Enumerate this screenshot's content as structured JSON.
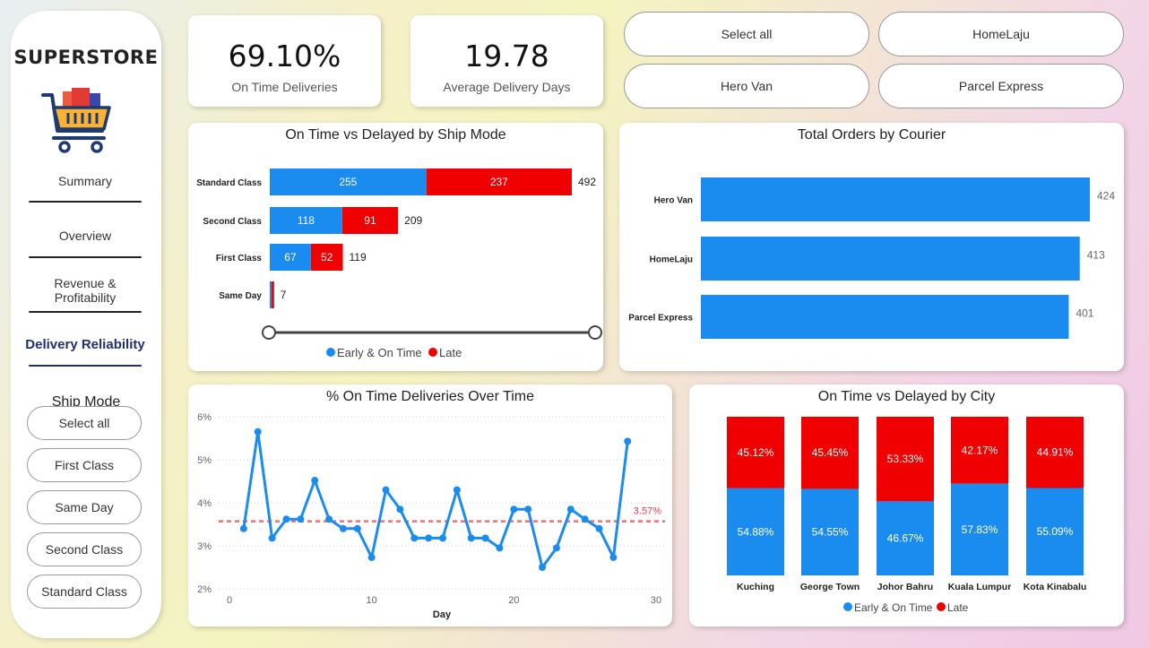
{
  "brand": "SUPERSTORE",
  "nav": [
    {
      "label": "Summary"
    },
    {
      "label": "Overview"
    },
    {
      "label": "Revenue & Profitability"
    },
    {
      "label": "Delivery Reliability"
    }
  ],
  "ship_mode_title": "Ship Mode",
  "ship_mode_buttons": [
    "Select all",
    "First Class",
    "Same Day",
    "Second Class",
    "Standard Class"
  ],
  "courier_buttons": [
    "Select all",
    "HomeLaju",
    "Hero Van",
    "Parcel Express"
  ],
  "kpis": [
    {
      "value": "69.10%",
      "label": "On Time Deliveries"
    },
    {
      "value": "19.78",
      "label": "Average Delivery Days"
    }
  ],
  "colors": {
    "on_time": "#1a8cf0",
    "late": "#f00000",
    "avg_line": "#f07070"
  },
  "chart_data": [
    {
      "type": "bar",
      "title": "On Time vs Delayed by Ship Mode",
      "categories": [
        "Standard Class",
        "Second Class",
        "First Class",
        "Same Day"
      ],
      "series": [
        {
          "name": "Early & On Time",
          "values": [
            255,
            118,
            67,
            3
          ]
        },
        {
          "name": "Late",
          "values": [
            237,
            91,
            52,
            4
          ]
        }
      ],
      "totals": [
        "492",
        "209",
        "119",
        "7"
      ],
      "segment_labels": [
        [
          "255",
          "237"
        ],
        [
          "118",
          "91"
        ],
        [
          "67",
          "52"
        ],
        [
          "",
          ""
        ]
      ],
      "legend": [
        "Early & On Time",
        "Late"
      ],
      "orientation": "horizontal-stacked"
    },
    {
      "type": "bar",
      "title": "Total Orders by Courier",
      "categories": [
        "Hero Van",
        "HomeLaju",
        "Parcel Express"
      ],
      "values": [
        424,
        413,
        401
      ],
      "value_labels": [
        "424",
        "413",
        "401"
      ],
      "orientation": "horizontal"
    },
    {
      "type": "line",
      "title": "% On Time Deliveries Over Time",
      "xlabel": "Day",
      "x": [
        1,
        2,
        3,
        4,
        5,
        6,
        7,
        8,
        9,
        10,
        11,
        12,
        13,
        14,
        15,
        16,
        17,
        18,
        19,
        20,
        21,
        22,
        23,
        24,
        25,
        26,
        27,
        28
      ],
      "y": [
        3.4,
        5.65,
        3.18,
        3.62,
        3.62,
        4.52,
        3.62,
        3.4,
        3.4,
        2.73,
        4.3,
        3.85,
        3.18,
        3.18,
        3.18,
        4.3,
        3.18,
        3.18,
        2.95,
        3.85,
        3.85,
        2.5,
        2.95,
        3.85,
        3.62,
        3.4,
        2.73,
        5.43
      ],
      "average": 3.57,
      "average_label": "3.57%",
      "xlim": [
        0,
        30
      ],
      "ylim": [
        2,
        6
      ],
      "xticks": [
        "0",
        "10",
        "20",
        "30"
      ],
      "yticks": [
        "2%",
        "3%",
        "4%",
        "5%",
        "6%"
      ]
    },
    {
      "type": "bar",
      "title": "On Time vs Delayed by City",
      "categories": [
        "Kuching",
        "George Town",
        "Johor Bahru",
        "Kuala Lumpur",
        "Kota Kinabalu"
      ],
      "series": [
        {
          "name": "Early & On Time",
          "values": [
            54.88,
            54.55,
            46.67,
            57.83,
            55.09
          ],
          "labels": [
            "54.88%",
            "54.55%",
            "46.67%",
            "57.83%",
            "55.09%"
          ]
        },
        {
          "name": "Late",
          "values": [
            45.12,
            45.45,
            53.33,
            42.17,
            44.91
          ],
          "labels": [
            "45.12%",
            "45.45%",
            "53.33%",
            "42.17%",
            "44.91%"
          ]
        }
      ],
      "legend": [
        "Early & On Time",
        "Late"
      ],
      "orientation": "vertical-100-stacked"
    }
  ]
}
